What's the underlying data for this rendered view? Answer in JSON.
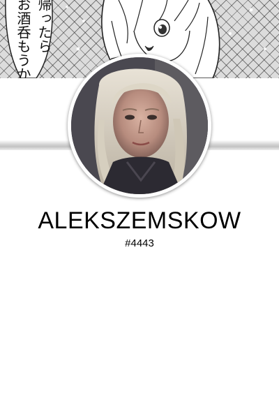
{
  "banner": {
    "caption_columns": [
      "帰ったら",
      "お酒呑もうか"
    ]
  },
  "profile": {
    "username": "ALEKSZEMSKOW",
    "discriminator": "#4443"
  },
  "colors": {
    "background": "#ffffff",
    "text": "#000000",
    "avatar_ring": "#ffffff"
  }
}
